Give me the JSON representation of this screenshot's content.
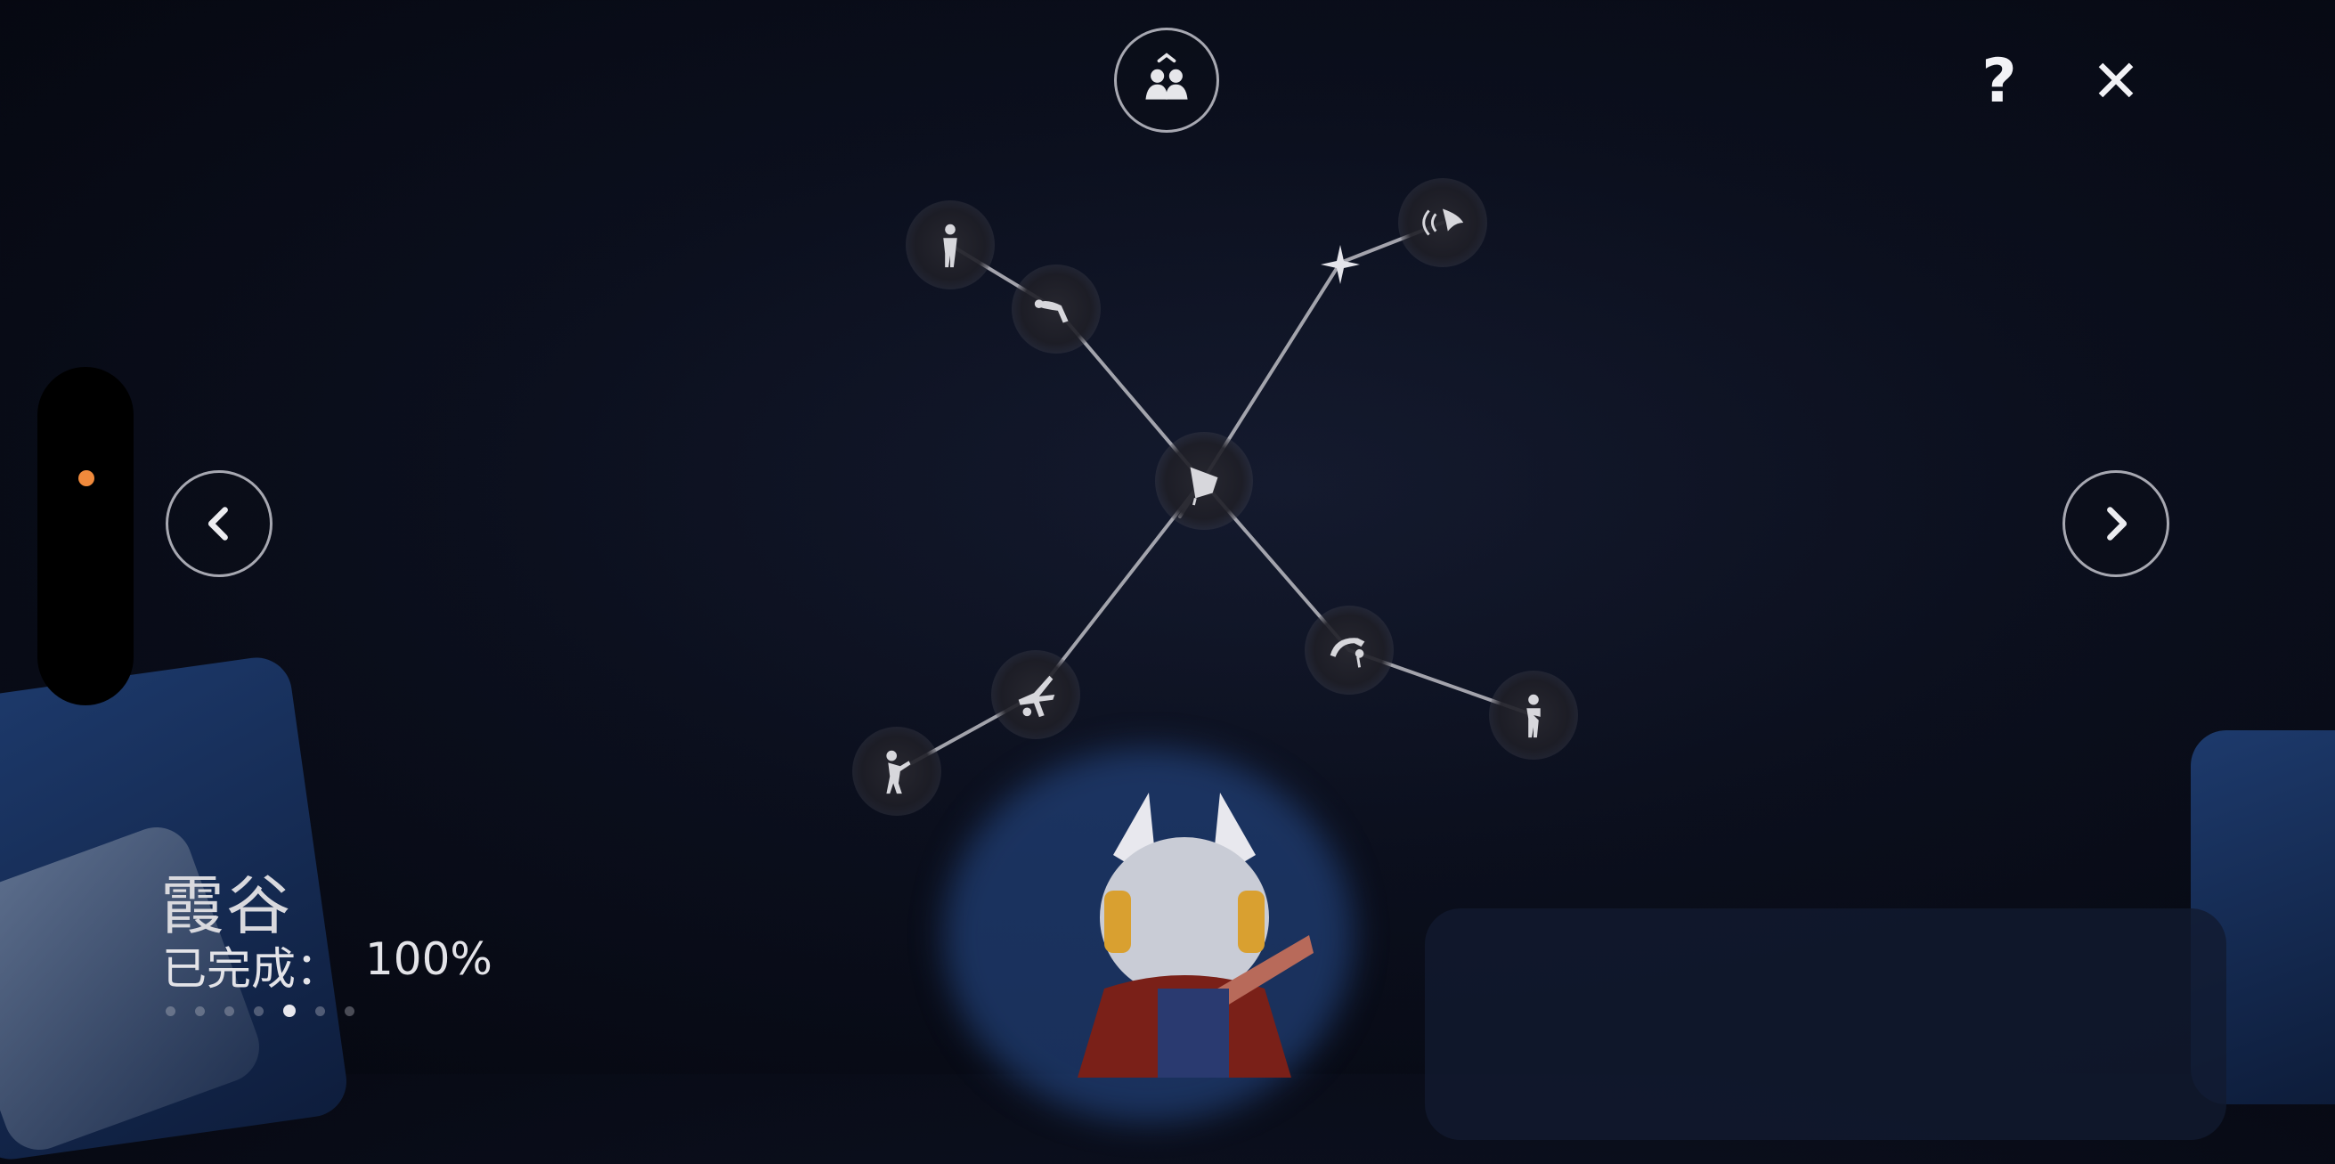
{
  "area": {
    "name": "霞谷",
    "progress_label": "已完成：",
    "progress_value": "100%"
  },
  "page_dots": {
    "count": 7,
    "active_index": 4
  },
  "controls": {
    "help_glyph": "?",
    "close_glyph": "✕"
  },
  "icons": {
    "friends": "friends-icon",
    "help": "question-icon",
    "close": "close-icon",
    "prev": "chevron-left-icon",
    "next": "chevron-right-icon"
  },
  "colors": {
    "indicator_dot": "#f08a3c",
    "constellation_line": "#bdbdc4"
  },
  "constellation": {
    "nodes": [
      {
        "id": "center",
        "icon": "emblem-icon"
      },
      {
        "id": "upper-left-outer",
        "icon": "stand-figure-icon"
      },
      {
        "id": "upper-left-inner",
        "icon": "bow-icon"
      },
      {
        "id": "upper-right",
        "icon": "manta-wave-icon"
      },
      {
        "id": "upper-right-star",
        "icon": "star-icon"
      },
      {
        "id": "lower-left-inner",
        "icon": "cartwheel-icon"
      },
      {
        "id": "lower-left-outer",
        "icon": "dance-icon"
      },
      {
        "id": "lower-right-inner",
        "icon": "backflip-icon"
      },
      {
        "id": "lower-right-outer",
        "icon": "crossed-arms-icon"
      }
    ]
  }
}
